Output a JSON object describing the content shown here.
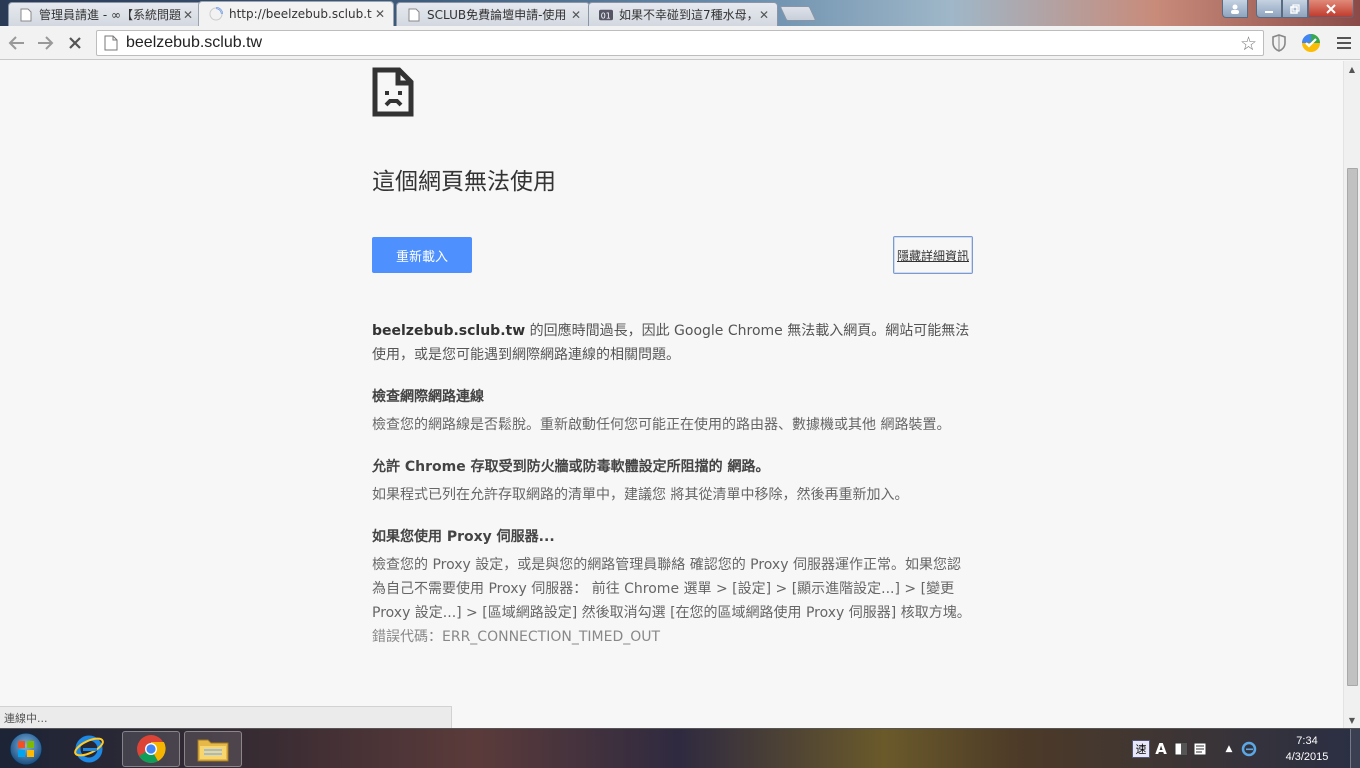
{
  "tabs": [
    {
      "title": "管理員請進 - ∞【系統問題",
      "active": false,
      "icon": "page-icon"
    },
    {
      "title": "http://beelzebub.sclub.t",
      "active": true,
      "icon": "loading-spinner-icon"
    },
    {
      "title": "SCLUB免費論壇申請-使用",
      "active": false,
      "icon": "page-icon"
    },
    {
      "title": "如果不幸碰到這7種水母，",
      "active": false,
      "icon": "o1-icon"
    }
  ],
  "toolbar": {
    "url": "beelzebub.sclub.tw"
  },
  "error_page": {
    "heading": "這個網頁無法使用",
    "reload_label": "重新載入",
    "details_label": "隱藏詳細資訊",
    "intro_host": "beelzebub.sclub.tw",
    "intro_text": " 的回應時間過長，因此 Google Chrome 無法載入網頁。網站可能無法使用，或是您可能遇到網際網路連線的相關問題。",
    "sections": [
      {
        "title": "檢查網際網路連線",
        "body": "檢查您的網路線是否鬆脫。重新啟動任何您可能正在使用的路由器、數據機或其他 網路裝置。"
      },
      {
        "title": "允許 Chrome 存取受到防火牆或防毒軟體設定所阻擋的 網路。",
        "body": "如果程式已列在允許存取網路的清單中，建議您 將其從清單中移除，然後再重新加入。"
      },
      {
        "title": "如果您使用 Proxy 伺服器...",
        "body": "檢查您的 Proxy 設定，或是與您的網路管理員聯絡 確認您的 Proxy 伺服器運作正常。如果您認為自己不需要使用 Proxy 伺服器： 前往 Chrome 選單 > [設定] > [顯示進階設定...] > [變更 Proxy 設定...] > [區域網路設定] 然後取消勾選 [在您的區域網路使用 Proxy 伺服器] 核取方塊。"
      }
    ],
    "error_code": "錯誤代碼：ERR_CONNECTION_TIMED_OUT"
  },
  "status_bar": "連線中...",
  "taskbar": {
    "clock_time": "7:34",
    "clock_date": "4/3/2015",
    "tray_ime": "速",
    "tray_letter": "A"
  },
  "colors": {
    "reload_button": "#4d90fe",
    "page_bg": "#f7f7f7"
  }
}
